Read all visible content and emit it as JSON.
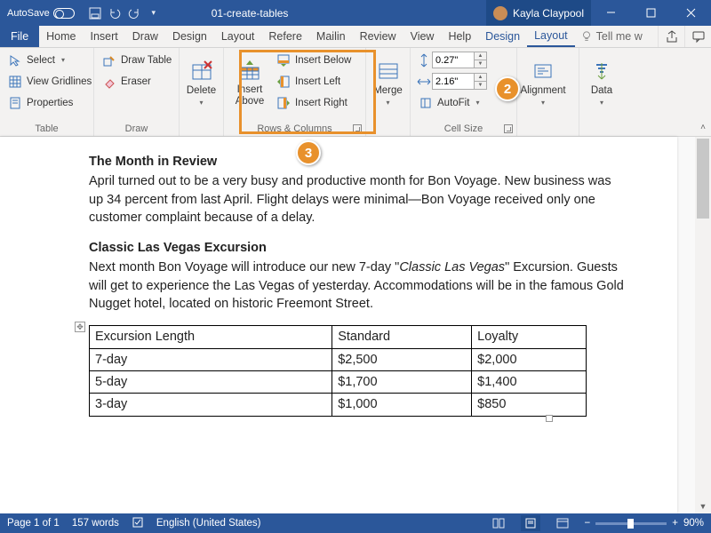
{
  "titlebar": {
    "autosave": "AutoSave",
    "docname": "01-create-tables",
    "user": "Kayla Claypool"
  },
  "tabs": {
    "file": "File",
    "home": "Home",
    "insert": "Insert",
    "draw": "Draw",
    "design": "Design",
    "layout1": "Layout",
    "refs": "Refere",
    "mail": "Mailin",
    "review": "Review",
    "view": "View",
    "help": "Help",
    "ctx_design": "Design",
    "ctx_layout": "Layout",
    "tellme": "Tell me w"
  },
  "ribbon": {
    "table": {
      "label": "Table",
      "select": "Select",
      "gridlines": "View Gridlines",
      "props": "Properties"
    },
    "draw": {
      "label": "Draw",
      "drawtable": "Draw Table",
      "eraser": "Eraser"
    },
    "delete": {
      "label": "Delete"
    },
    "rowscols": {
      "label": "Rows & Columns",
      "above": "Insert Above",
      "below": "Insert Below",
      "left": "Insert Left",
      "right": "Insert Right"
    },
    "merge": {
      "label": "Merge"
    },
    "cellsize": {
      "label": "Cell Size",
      "height": "0.27\"",
      "width": "2.16\"",
      "autofit": "AutoFit"
    },
    "alignment": {
      "label": "Alignment"
    },
    "data": {
      "label": "Data"
    }
  },
  "callouts": {
    "c2": "2",
    "c3": "3"
  },
  "document": {
    "h1": "The Month in Review",
    "p1": "April turned out to be a very busy and productive month for Bon Voyage. New business was up 34 percent from last April. Flight delays were minimal—Bon Voyage received only one customer complaint because of a delay.",
    "h2": "Classic Las Vegas Excursion",
    "p2a": "Next month Bon Voyage will introduce our new 7-day \"",
    "p2em": "Classic Las Vegas",
    "p2b": "\" Excursion. Guests will get to experience the Las Vegas of yesterday. Accommodations will be in the famous Gold Nugget hotel, located on historic Freemont Street.",
    "table": {
      "headers": [
        "Excursion Length",
        "Standard",
        "Loyalty"
      ],
      "rows": [
        [
          "7-day",
          "$2,500",
          "$2,000"
        ],
        [
          "5-day",
          "$1,700",
          "$1,400"
        ],
        [
          "3-day",
          "$1,000",
          "$850"
        ]
      ]
    }
  },
  "status": {
    "page": "Page 1 of 1",
    "words": "157 words",
    "lang": "English (United States)",
    "zoom_minus": "−",
    "zoom_plus": "+",
    "zoom": "90%"
  }
}
